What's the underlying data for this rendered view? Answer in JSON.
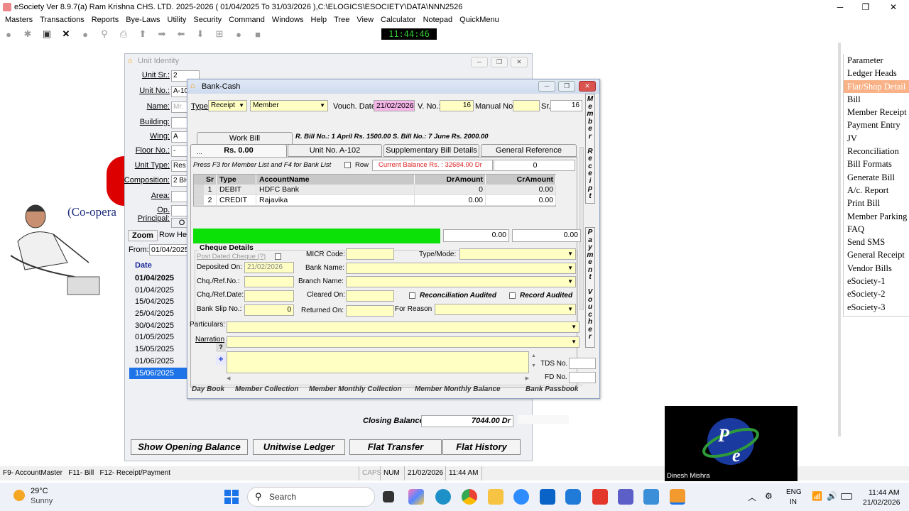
{
  "app": {
    "title": "eSociety Ver 8.9.7(a)  Ram Krishna CHS. LTD.  2025-2026  ( 01/04/2025 To 31/03/2026 ),C:\\ELOGICS\\ESOCIETY\\DATA\\NNN2526",
    "clock": "11:44:46"
  },
  "menu": [
    "Masters",
    "Transactions",
    "Reports",
    "Bye-Laws",
    "Utility",
    "Security",
    "Command",
    "Windows",
    "Help",
    "Tree",
    "View",
    "Calculator",
    "Notepad",
    "QuickMenu"
  ],
  "right_menu": {
    "items": [
      "Parameter",
      "Ledger Heads",
      "Flat/Shop Detail",
      "Bill",
      "Member Receipt",
      "Payment Entry",
      "JV",
      "Reconciliation",
      "Bill Formats",
      "Generate Bill",
      "A/c. Report",
      "Print Bill",
      "Member Parking",
      "FAQ",
      "Send SMS",
      "General Receipt",
      "Vendor Bills",
      "eSociety-1",
      "eSociety-2",
      "eSociety-3"
    ],
    "active": "Flat/Shop Detail"
  },
  "unit_window": {
    "title": "Unit Identity",
    "fields": [
      {
        "label": "Unit Sr.:",
        "value": "2"
      },
      {
        "label": "Unit No.:",
        "value": "A-10"
      },
      {
        "label": "Name:",
        "value": "Mr."
      },
      {
        "label": "Building:",
        "value": ""
      },
      {
        "label": "Wing:",
        "value": "A"
      },
      {
        "label": "Floor No.:",
        "value": "-"
      },
      {
        "label": "Unit Type:",
        "value": "Res"
      },
      {
        "label": "Composition:",
        "value": "2 BH"
      },
      {
        "label": "Area:",
        "value": ""
      },
      {
        "label": "Op. Principal:",
        "value": ""
      }
    ],
    "zoom_label": "Zoom",
    "row_height_label": "Row Hei",
    "from_label": "From:",
    "from_value": "01/04/2025",
    "date_header": "Date",
    "dates": [
      "01/04/2025",
      "01/04/2025",
      "15/04/2025",
      "25/04/2025",
      "30/04/2025",
      "01/05/2025",
      "15/05/2025",
      "01/06/2025",
      "15/06/2025"
    ],
    "closing_balance_label": "Closing Balance:",
    "closing_balance_value": "7044.00 Dr",
    "buttons": [
      "Show Opening Balance",
      "Unitwise Ledger",
      "Flat Transfer",
      "Flat History"
    ],
    "behind_text": "(Co-opera",
    "cut_tab": "O"
  },
  "bank_window": {
    "title": "Bank-Cash",
    "type_label": "Type:",
    "type_value": "Receipt",
    "member_value": "Member",
    "vouch_date_label": "Vouch. Date:",
    "vouch_date_value": "21/02/2026",
    "vno_label": "V. No.:",
    "vno_value": "16",
    "manual_label": "Manual No.:",
    "manual_value": "",
    "sr_label": "Sr.:",
    "sr_value": "16",
    "work_bill_tab": "Work Bill",
    "bill_info": "R. Bill No.: 1 April Rs. 1500.00 S. Bill No.: 7 June Rs. 2000.00",
    "tabs": [
      "Rs. 0.00",
      "Unit No. A-102",
      "Supplementary Bill Details",
      "General Reference"
    ],
    "hint": "Press F3 for Member List and F4 for Bank List",
    "row_label": "Row",
    "current_balance": "Current Balance Rs. : 32684.00  Dr",
    "current_balance_box": "0",
    "grid_headers": [
      "Sr",
      "Type",
      "AccountName",
      "DrAmount",
      "CrAmount"
    ],
    "grid_rows": [
      {
        "sr": "1",
        "type": "DEBIT",
        "account": "HDFC Bank",
        "dr": "0",
        "cr": "0.00"
      },
      {
        "sr": "2",
        "type": "CREDIT",
        "account": "Rajavika",
        "dr": "0.00",
        "cr": "0.00"
      }
    ],
    "total_dr": "0.00",
    "total_cr": "0.00",
    "cheque": {
      "title": "Cheque Details",
      "post_dated_label": "Post Dated Cheque (?)",
      "micr_label": "MICR Code:",
      "type_mode_label": "Type/Mode:",
      "deposited_label": "Deposited On:",
      "deposited_value": "21/02/2026",
      "bank_name_label": "Bank Name:",
      "chq_no_label": "Chq./Ref.No.:",
      "branch_label": "Branch Name:",
      "chq_date_label": "Chq./Ref.Date:",
      "cleared_label": "Cleared On:",
      "recon_label": "Reconciliation Audited",
      "record_label": "Record Audited",
      "bank_slip_label": "Bank Slip No.:",
      "bank_slip_value": "0",
      "returned_label": "Returned On:",
      "reason_label": "For Reason"
    },
    "particulars_label": "Particulars:",
    "narration_label": "Narration",
    "tds_label": "TDS No.",
    "fd_label": "FD No.",
    "footer_links": [
      "Day Book",
      "Member Collection",
      "Member Monthly Collection",
      "Member Monthly Balance",
      "Bank Passbook"
    ],
    "side_receipt": "Member Receipt",
    "side_payment": "Payment Voucher"
  },
  "status": {
    "keys": "F9- AccountMaster   F11- Bill   F12- Receipt/Payment",
    "caps": "CAPS",
    "num": "NUM",
    "date": "21/02/2026",
    "time": "11:44 AM"
  },
  "video": {
    "name": "Dinesh Mishra"
  },
  "taskbar": {
    "temp": "29°C",
    "weather": "Sunny",
    "search": "Search",
    "lang1": "ENG",
    "lang2": "IN",
    "time": "11:44 AM",
    "date": "21/02/2026"
  }
}
